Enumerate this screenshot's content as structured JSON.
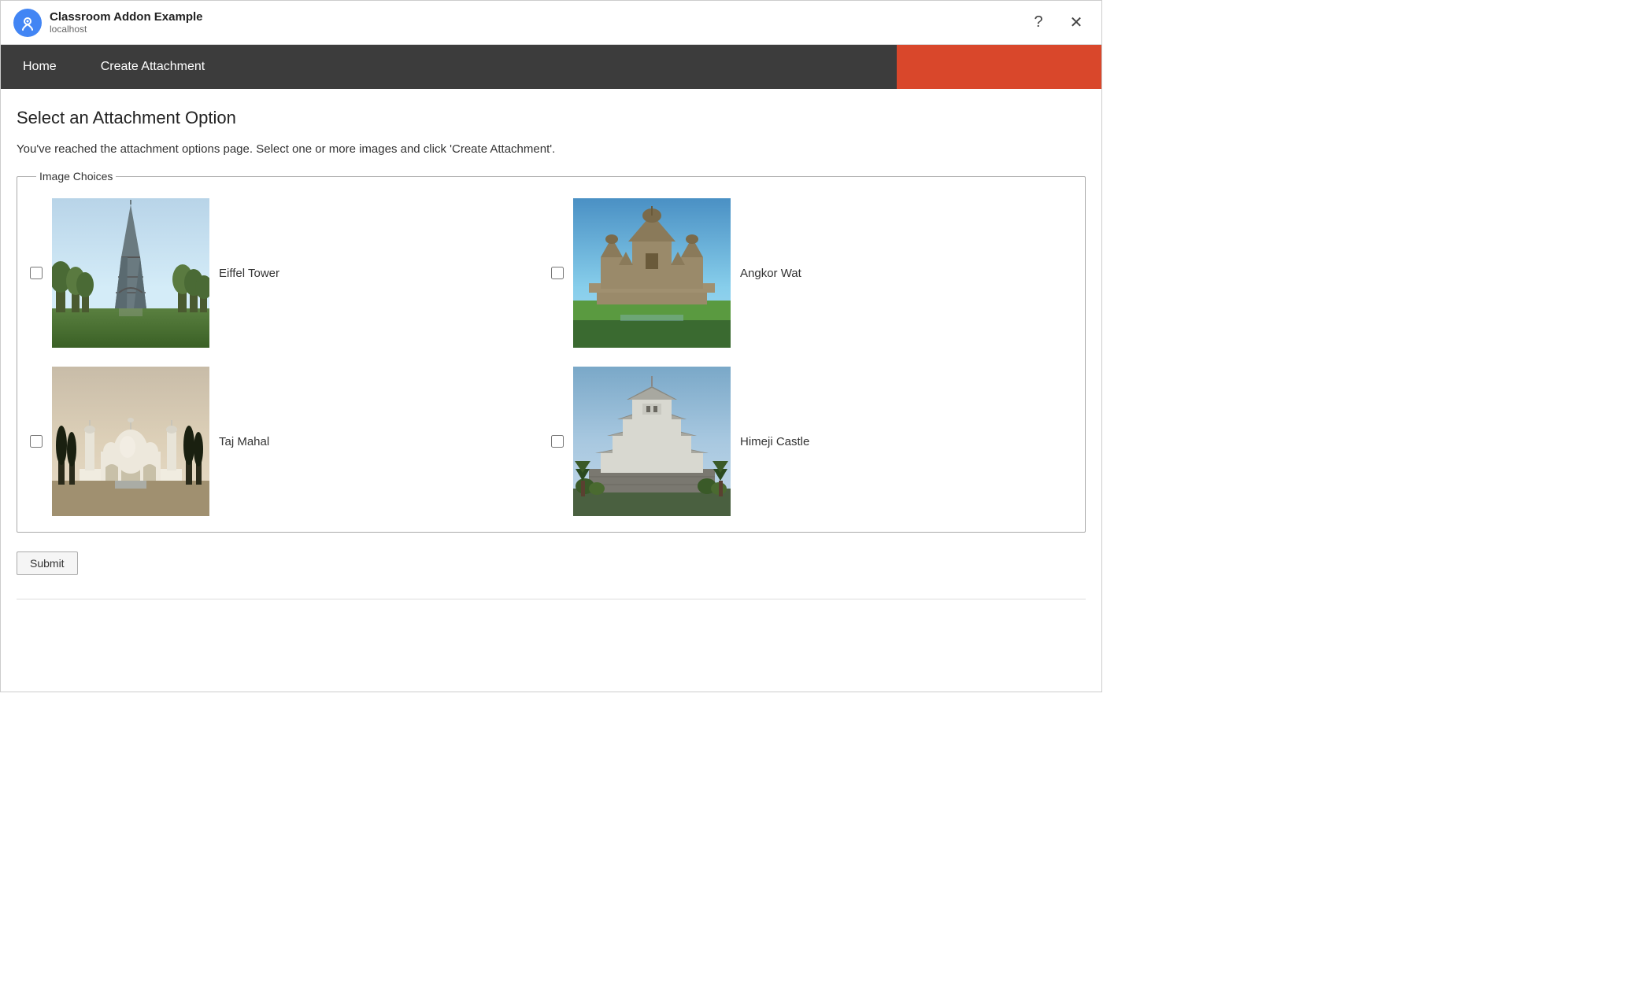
{
  "titleBar": {
    "appName": "Classroom Addon Example",
    "url": "localhost",
    "helpLabel": "?",
    "closeLabel": "×"
  },
  "navBar": {
    "items": [
      {
        "id": "home",
        "label": "Home",
        "active": false
      },
      {
        "id": "create-attachment",
        "label": "Create Attachment",
        "active": true
      }
    ]
  },
  "main": {
    "pageTitle": "Select an Attachment Option",
    "pageDescription": "You've reached the attachment options page. Select one or more images and click 'Create Attachment'.",
    "fieldsetLegend": "Image Choices",
    "images": [
      {
        "id": "eiffel-tower",
        "label": "Eiffel Tower",
        "checked": false
      },
      {
        "id": "angkor-wat",
        "label": "Angkor Wat",
        "checked": false
      },
      {
        "id": "taj-mahal",
        "label": "Taj Mahal",
        "checked": false
      },
      {
        "id": "himeji-castle",
        "label": "Himeji Castle",
        "checked": false
      }
    ],
    "submitLabel": "Submit"
  }
}
